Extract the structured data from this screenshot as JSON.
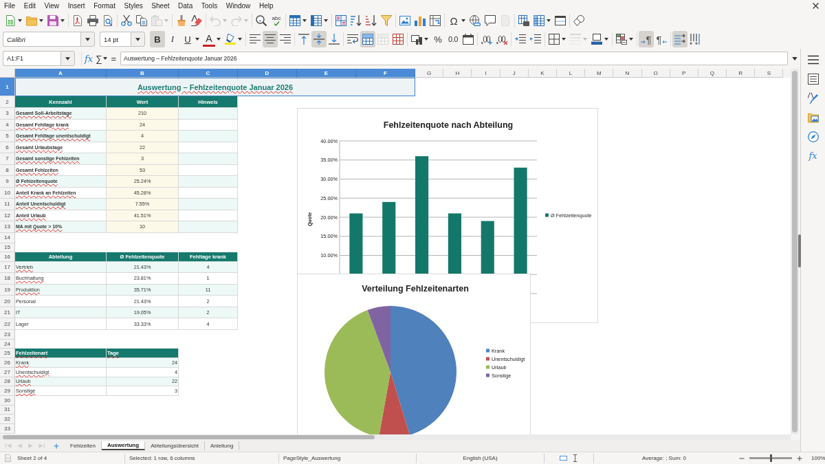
{
  "menu_bar": {
    "items": [
      "File",
      "Edit",
      "View",
      "Insert",
      "Format",
      "Styles",
      "Sheet",
      "Data",
      "Tools",
      "Window",
      "Help"
    ]
  },
  "standard_toolbar": {
    "paste": {
      "disabled": true
    },
    "undo": {
      "disabled": true
    },
    "redo": {
      "disabled": true
    },
    "spelling": {
      "label": "abc"
    },
    "special_character": {
      "label": "Ω"
    },
    "headers_footers": {
      "disabled": true
    }
  },
  "formatting_toolbar": {
    "font_name": "Calibri",
    "font_size": "14 pt",
    "bold": {
      "label": "B",
      "on": true
    },
    "italic": {
      "label": "I",
      "on": false
    },
    "underline": {
      "label": "U",
      "on": false
    },
    "font_color": {
      "label": "A"
    },
    "align_left": {
      "on": false
    },
    "align_center": {
      "on": true
    },
    "align_right": {
      "on": false
    },
    "align_top": {
      "on": false
    },
    "align_middle": {
      "on": true
    },
    "align_bottom": {
      "on": false
    },
    "wrap_text": {
      "on": false
    },
    "merge_and_center": {
      "on": true
    },
    "merge_cells": {
      "disabled": true
    },
    "percent": {
      "label": "%"
    },
    "number": {
      "label": "0.0"
    },
    "border_style": {
      "disabled": true
    },
    "left_to_right": {
      "label": "¶",
      "on": true
    },
    "right_to_left": {
      "label": "¶",
      "on": false
    },
    "horizontal_text": {
      "on": true
    },
    "vertical_text": {
      "on": false
    }
  },
  "formula_bar": {
    "name_box": "A1:F1",
    "function_wizard": "fx",
    "sum": "∑",
    "formula": "=",
    "content": "Auswertung – Fehlzeitenquote Januar 2026"
  },
  "sheet": {
    "column_headers": [
      {
        "label": "A",
        "selected": true
      },
      {
        "label": "B",
        "selected": true
      },
      {
        "label": "C",
        "selected": true
      },
      {
        "label": "D",
        "selected": true
      },
      {
        "label": "E",
        "selected": true
      },
      {
        "label": "F",
        "selected": true
      },
      {
        "label": "G",
        "selected": false
      },
      {
        "label": "H",
        "selected": false
      },
      {
        "label": "I",
        "selected": false
      },
      {
        "label": "J",
        "selected": false
      },
      {
        "label": "K",
        "selected": false
      },
      {
        "label": "L",
        "selected": false
      },
      {
        "label": "M",
        "selected": false
      },
      {
        "label": "N",
        "selected": false
      },
      {
        "label": "O",
        "selected": false
      },
      {
        "label": "P",
        "selected": false
      },
      {
        "label": "Q",
        "selected": false
      },
      {
        "label": "R",
        "selected": false
      },
      {
        "label": "S",
        "selected": false
      }
    ],
    "row_headers": [
      {
        "label": "1",
        "selected": true
      },
      {
        "label": "2",
        "selected": false
      },
      {
        "label": "3",
        "selected": false
      },
      {
        "label": "4",
        "selected": false
      },
      {
        "label": "5",
        "selected": false
      },
      {
        "label": "6",
        "selected": false
      },
      {
        "label": "7",
        "selected": false
      },
      {
        "label": "8",
        "selected": false
      },
      {
        "label": "9",
        "selected": false
      },
      {
        "label": "10",
        "selected": false
      },
      {
        "label": "11",
        "selected": false
      },
      {
        "label": "12",
        "selected": false
      },
      {
        "label": "13",
        "selected": false
      },
      {
        "label": "14",
        "selected": false
      },
      {
        "label": "15",
        "selected": false
      },
      {
        "label": "16",
        "selected": false
      },
      {
        "label": "17",
        "selected": false
      },
      {
        "label": "18",
        "selected": false
      },
      {
        "label": "19",
        "selected": false
      },
      {
        "label": "20",
        "selected": false
      },
      {
        "label": "21",
        "selected": false
      },
      {
        "label": "22",
        "selected": false
      },
      {
        "label": "23",
        "selected": false
      },
      {
        "label": "24",
        "selected": false
      },
      {
        "label": "25",
        "selected": false
      },
      {
        "label": "26",
        "selected": false
      },
      {
        "label": "27",
        "selected": false
      },
      {
        "label": "28",
        "selected": false
      },
      {
        "label": "29",
        "selected": false
      },
      {
        "label": "30",
        "selected": false
      },
      {
        "label": "31",
        "selected": false
      },
      {
        "label": "32",
        "selected": false
      },
      {
        "label": "33",
        "selected": false
      }
    ],
    "title": {
      "text": "Auswertung – Fehlzeitenquote Januar 2026",
      "spell_error": true
    },
    "summary_table": {
      "header": [
        {
          "text": "Kennzahl",
          "spell_error": false
        },
        {
          "text": "Wert",
          "spell_error": false
        },
        {
          "text": "Hinweis",
          "spell_error": false
        }
      ],
      "rows": [
        {
          "label": "Gesamt Soll-Arbeitstage",
          "spell_error": true,
          "value": "210"
        },
        {
          "label": "Gesamt Fehltage krank",
          "spell_error": true,
          "value": "24"
        },
        {
          "label": "Gesamt Fehltage unentschuldigt",
          "spell_error": true,
          "value": "4"
        },
        {
          "label": "Gesamt Urlaubstage",
          "spell_error": true,
          "value": "22"
        },
        {
          "label": "Gesamt sonstige Fehlzeiten",
          "spell_error": true,
          "value": "3"
        },
        {
          "label": "Gesamt Fehlzeiten",
          "spell_error": true,
          "value": "53"
        },
        {
          "label": "Ø Fehlzeitenquote",
          "spell_error": true,
          "value": "25.24%"
        },
        {
          "label": "Anteil Krank an Fehlzeiten",
          "spell_error": true,
          "value": "45.28%"
        },
        {
          "label": "Anteil Unentschuldigt",
          "spell_error": true,
          "value": "7.55%"
        },
        {
          "label": "Anteil Urlaub",
          "spell_error": true,
          "value": "41.51%"
        },
        {
          "label": "MA mit Quote > 10%",
          "spell_error": true,
          "value": "10"
        }
      ]
    },
    "department_table": {
      "header": [
        {
          "text": "Abteilung",
          "spell_error": false
        },
        {
          "text": "Ø Fehlzeitenquote",
          "spell_error": false
        },
        {
          "text": "Fehltage krank",
          "spell_error": false
        }
      ],
      "rows": [
        {
          "label": "Vertrieb",
          "spell_error": true,
          "rate": "21.43%",
          "sick_days": "4"
        },
        {
          "label": "Buchhaltung",
          "spell_error": true,
          "rate": "23.81%",
          "sick_days": "1"
        },
        {
          "label": "Produktion",
          "spell_error": true,
          "rate": "35.71%",
          "sick_days": "11"
        },
        {
          "label": "Personal",
          "spell_error": false,
          "rate": "21.43%",
          "sick_days": "2"
        },
        {
          "label": "IT",
          "spell_error": false,
          "rate": "19.05%",
          "sick_days": "2"
        },
        {
          "label": "Lager",
          "spell_error": false,
          "rate": "33.33%",
          "sick_days": "4"
        }
      ]
    },
    "absence_type_table": {
      "header": [
        {
          "text": "Fehlzeitenart",
          "spell_error": true
        },
        {
          "text": "Tage",
          "spell_error": true
        }
      ],
      "rows": [
        {
          "label": "Krank",
          "spell_error": true,
          "days": "24"
        },
        {
          "label": "Unentschuldigt",
          "spell_error": true,
          "days": "4"
        },
        {
          "label": "Urlaub",
          "spell_error": true,
          "days": "22"
        },
        {
          "label": "Sonstige",
          "spell_error": true,
          "days": "3"
        }
      ]
    },
    "bar_chart": {
      "chart_data": {
        "type": "bar",
        "title": "Fehlzeitenquote nach Abteilung",
        "ylabel": "Quote",
        "series": [
          {
            "name": "Ø Fehlzeitenquote",
            "color": "#13786a",
            "values": [
              0.21,
              0.24,
              0.36,
              0.21,
              0.19,
              0.33
            ]
          }
        ],
        "ylim": [
          0,
          0.4
        ],
        "yticks": [
          {
            "value": 0.1,
            "label": "10.00%"
          },
          {
            "value": 0.15,
            "label": "15.00%"
          },
          {
            "value": 0.2,
            "label": "20.00%"
          },
          {
            "value": 0.25,
            "label": "25.00%"
          },
          {
            "value": 0.3,
            "label": "30.00%"
          },
          {
            "value": 0.35,
            "label": "35.00%"
          },
          {
            "value": 0.4,
            "label": "40.00%"
          }
        ],
        "grid": true,
        "legend": true
      }
    },
    "pie_chart": {
      "chart_data": {
        "type": "pie",
        "title": "Verteilung Fehlzeitenarten",
        "categories": [
          "Krank",
          "Unentschuldigt",
          "Urlaub",
          "Sonstige"
        ],
        "values": [
          45.28,
          7.55,
          41.51,
          5.66
        ],
        "colors": [
          "#4f81bd",
          "#c0504d",
          "#9bbb59",
          "#8064a2"
        ],
        "legend": true
      }
    }
  },
  "sidebar": {
    "functions": "fx"
  },
  "sheet_tabs": [
    {
      "label": "Fehlzeiten",
      "selected": false
    },
    {
      "label": "Auswertung",
      "selected": true
    },
    {
      "label": "Abteilungsübersicht",
      "selected": false
    },
    {
      "label": "Anleitung",
      "selected": false
    }
  ],
  "status_bar": {
    "sheet": "Sheet 2 of 4",
    "selection": "Selected: 1 row, 6 columns",
    "page_style": "PageStyle_Auswertung",
    "language": "English (USA)",
    "statistics": "Average: ; Sum: 0",
    "zoom_slider": {
      "level": 0.5
    },
    "zoom": "100%"
  }
}
